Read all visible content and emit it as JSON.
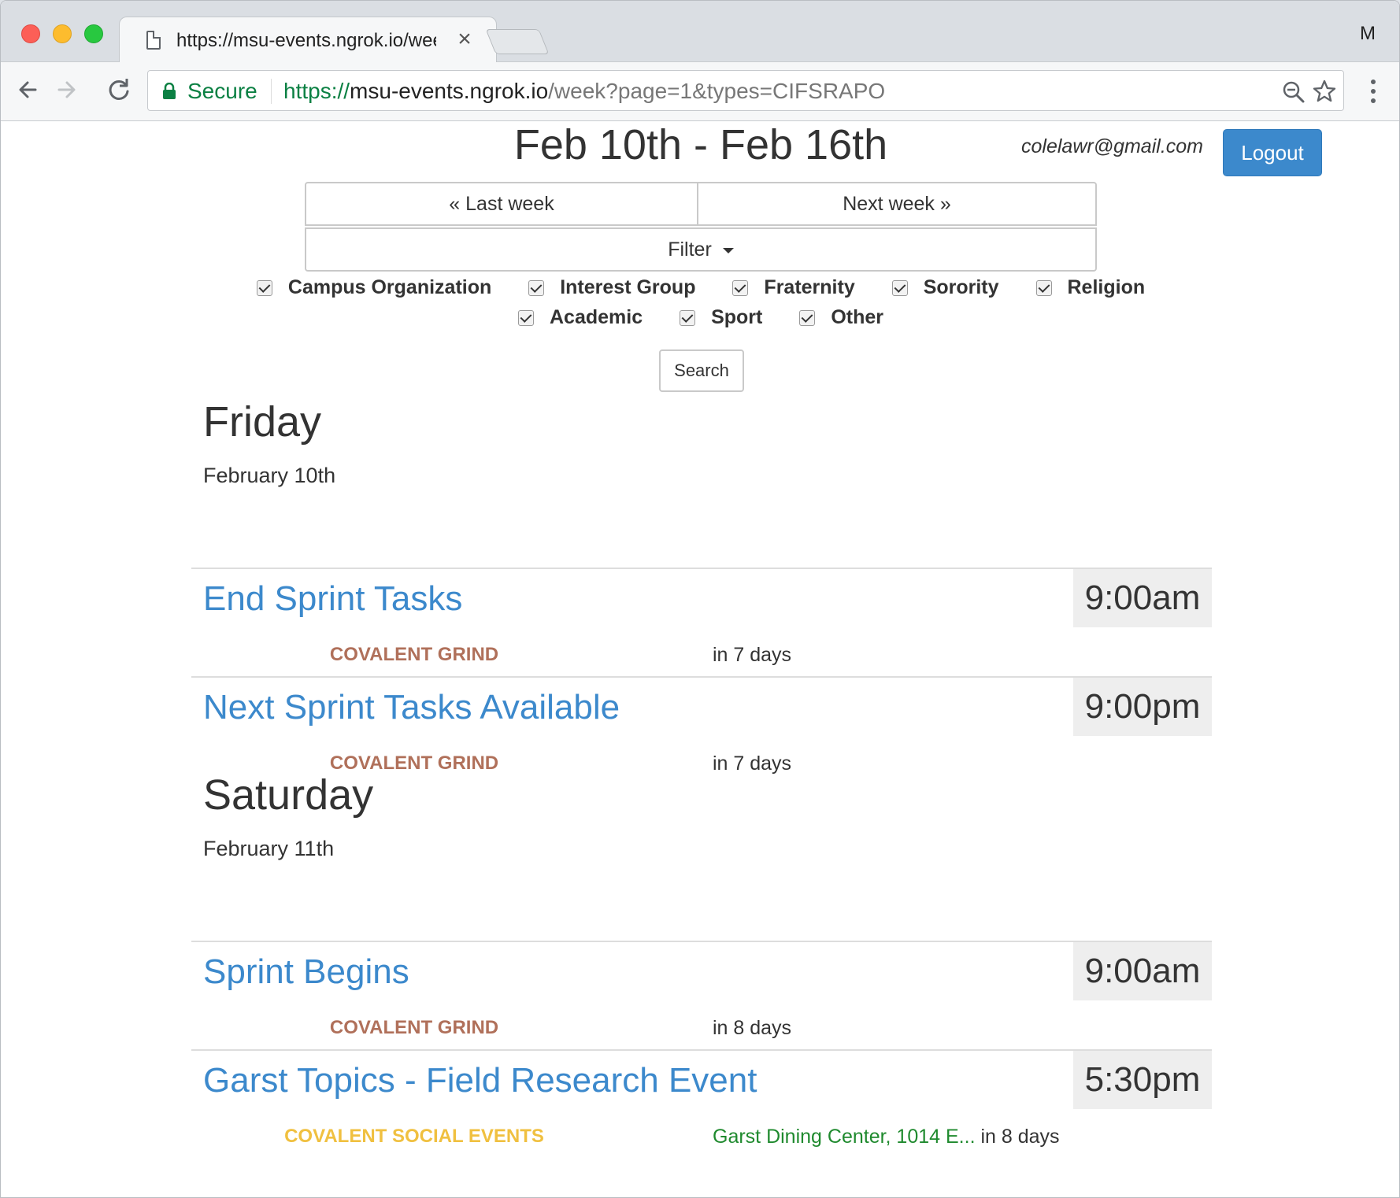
{
  "browser": {
    "tab_title": "https://msu-events.ngrok.io/week?page=1&types=CIFSRAPO",
    "tab_close": "×",
    "profile_letter": "M",
    "secure_label": "Secure",
    "url_scheme": "https://",
    "url_host": "msu-events.ngrok.io",
    "url_path": "/week?page=1&types=CIFSRAPO"
  },
  "header": {
    "week_title": "Feb 10th - Feb 16th",
    "user_email": "colelawr@gmail.com",
    "logout_label": "Logout"
  },
  "nav": {
    "last_week_label": "« Last week",
    "next_week_label": "Next week »",
    "filter_label": "Filter"
  },
  "filters": [
    {
      "label": "Campus Organization",
      "checked": true
    },
    {
      "label": "Interest Group",
      "checked": true
    },
    {
      "label": "Fraternity",
      "checked": true
    },
    {
      "label": "Sorority",
      "checked": true
    },
    {
      "label": "Religion",
      "checked": true
    },
    {
      "label": "Academic",
      "checked": true
    },
    {
      "label": "Sport",
      "checked": true
    },
    {
      "label": "Other",
      "checked": true
    }
  ],
  "search_label": "Search",
  "days": [
    {
      "name": "Friday",
      "date": "February 10th",
      "events": [
        {
          "title": "End Sprint Tasks",
          "time": "9:00am",
          "group": "COVALENT GRIND",
          "location": "",
          "relative": "in 7 days"
        },
        {
          "title": "Next Sprint Tasks Available",
          "time": "9:00pm",
          "group": "COVALENT GRIND",
          "location": "",
          "relative": "in 7 days"
        }
      ]
    },
    {
      "name": "Saturday",
      "date": "February 11th",
      "events": [
        {
          "title": "Sprint Begins",
          "time": "9:00am",
          "group": "COVALENT GRIND",
          "location": "",
          "relative": "in 8 days"
        },
        {
          "title": "Garst Topics - Field Research Event",
          "time": "5:30pm",
          "group": "COVALENT SOCIAL EVENTS",
          "location": "Garst Dining Center, 1014 E...",
          "relative": "in 8 days"
        }
      ]
    }
  ],
  "colors": {
    "link_blue": "#3c89cc",
    "group_grind": "#b0705a",
    "group_social": "#f0c040",
    "location_green": "#1f8a2e",
    "secure_green": "#0b8043"
  }
}
